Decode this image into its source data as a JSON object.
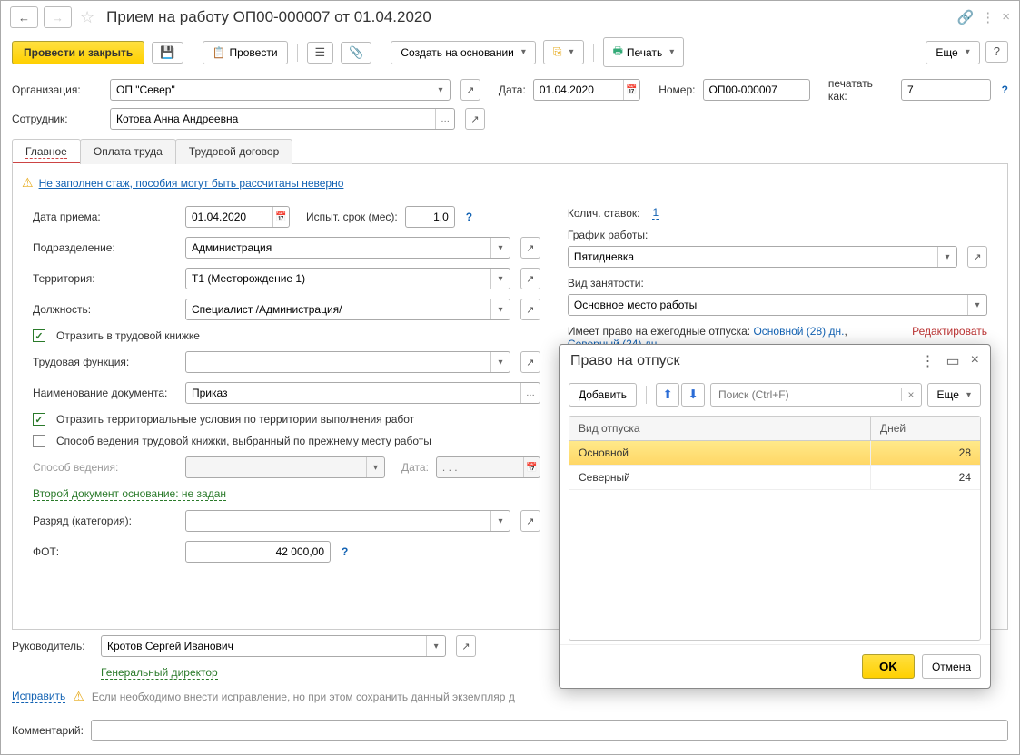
{
  "title": "Прием на работу ОП00-000007 от 01.04.2020",
  "toolbar": {
    "post_close": "Провести и закрыть",
    "post": "Провести",
    "create_based": "Создать на основании",
    "print": "Печать",
    "more": "Еще"
  },
  "header": {
    "org_label": "Организация:",
    "org_value": "ОП \"Север\"",
    "date_label": "Дата:",
    "date_value": "01.04.2020",
    "number_label": "Номер:",
    "number_value": "ОП00-000007",
    "printas_label": "печатать как:",
    "printas_value": "7",
    "employee_label": "Сотрудник:",
    "employee_value": "Котова Анна Андреевна"
  },
  "tabs": [
    "Главное",
    "Оплата труда",
    "Трудовой договор"
  ],
  "warning": "Не заполнен стаж, пособия могут быть рассчитаны неверно",
  "main": {
    "hire_date_label": "Дата приема:",
    "hire_date": "01.04.2020",
    "trial_label": "Испыт. срок (мес):",
    "trial": "1,0",
    "dept_label": "Подразделение:",
    "dept": "Администрация",
    "terr_label": "Территория:",
    "terr": "Т1 (Месторождение 1)",
    "position_label": "Должность:",
    "position": "Специалист /Администрация/",
    "workbook_label": "Отразить в трудовой книжке",
    "func_label": "Трудовая функция:",
    "func": "",
    "docname_label": "Наименование документа:",
    "docname": "Приказ",
    "terr_cond_label": "Отразить территориальные условия по территории выполнения работ",
    "book_method_label": "Способ ведения трудовой книжки, выбранный по прежнему месту работы",
    "method_label": "Способ ведения:",
    "date2_label": "Дата:",
    "second_doc": "Второй документ основание: не задан",
    "category_label": "Разряд (категория):",
    "fot_label": "ФОТ:",
    "fot": "42 000,00"
  },
  "right": {
    "rates_label": "Колич. ставок:",
    "rates": "1",
    "schedule_label": "График работы:",
    "schedule": "Пятидневка",
    "emp_type_label": "Вид занятости:",
    "emp_type": "Основное место работы",
    "leave_label": "Имеет право на ежегодные отпуска:",
    "leave_main": "Основной (28) дн.",
    "leave_north": "Северный (24) дн.",
    "edit": "Редактировать"
  },
  "footer": {
    "manager_label": "Руководитель:",
    "manager": "Кротов Сергей Иванович",
    "manager_title": "Генеральный директор",
    "fix": "Исправить",
    "fix_note": "Если необходимо внести исправление, но при этом сохранить данный экземпляр д",
    "comment_label": "Комментарий:"
  },
  "modal": {
    "title": "Право на отпуск",
    "add": "Добавить",
    "search_ph": "Поиск (Ctrl+F)",
    "more": "Еще",
    "col1": "Вид отпуска",
    "col2": "Дней",
    "rows": [
      {
        "name": "Основной",
        "days": "28"
      },
      {
        "name": "Северный",
        "days": "24"
      }
    ],
    "ok": "OK",
    "cancel": "Отмена"
  }
}
